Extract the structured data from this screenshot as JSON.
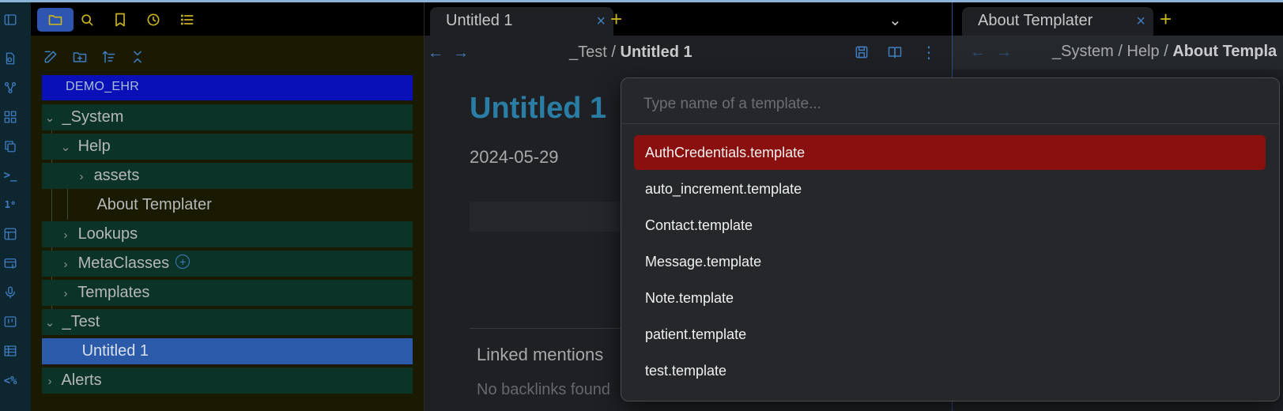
{
  "ribbon": {
    "icons": [
      "sidebar-toggle-icon",
      "new-note-icon",
      "graph-icon",
      "canvas-icon",
      "copy-icon",
      "terminal-icon",
      "numbers-icon",
      "template-icon",
      "card-add-icon",
      "microphone-icon",
      "kanban-icon",
      "table-icon",
      "templater-icon"
    ],
    "terminal_glyph": ">_",
    "numbers_glyph": "1⁰",
    "templater_glyph": "<%"
  },
  "sidebar": {
    "vault_name": "DEMO_EHR",
    "tree": [
      {
        "label": "_System",
        "chevron": "⌄"
      },
      {
        "label": "Help",
        "chevron": "⌄"
      },
      {
        "label": "assets",
        "chevron": "›"
      },
      {
        "label": "About Templater",
        "chevron": ""
      },
      {
        "label": "Lookups",
        "chevron": "›"
      },
      {
        "label": "MetaClasses",
        "chevron": "›"
      },
      {
        "label": "Templates",
        "chevron": "›"
      },
      {
        "label": "_Test",
        "chevron": "⌄"
      },
      {
        "label": "Untitled 1",
        "chevron": ""
      },
      {
        "label": "Alerts",
        "chevron": "›"
      }
    ],
    "plus_glyph": "+"
  },
  "editor": {
    "tab_title": "Untitled 1",
    "tab_close": "×",
    "new_tab": "+",
    "tab_list": "⌄",
    "back": "←",
    "forward": "→",
    "breadcrumb_parent": "_Test",
    "breadcrumb_sep": "/",
    "breadcrumb_current": "Untitled 1",
    "more": "⋮",
    "note_title": "Untitled 1",
    "note_date": "2024-05-29",
    "linked_mentions": "Linked mentions",
    "no_backlinks": "No backlinks found"
  },
  "right_pane": {
    "tab_title": "About Templater",
    "tab_close": "×",
    "new_tab": "+",
    "back": "←",
    "forward": "→",
    "breadcrumb_a": "_System",
    "breadcrumb_b": "Help",
    "breadcrumb_sep": "/",
    "breadcrumb_current": "About Templa"
  },
  "template_picker": {
    "placeholder": "Type name of a template...",
    "suggestions": [
      "AuthCredentials.template",
      "auto_increment.template",
      "Contact.template",
      "Message.template",
      "Note.template",
      "patient.template",
      "test.template"
    ],
    "active_index": 0
  },
  "colors": {
    "accent_blue": "#3f7dc0",
    "accent_yellow": "#c9b21f",
    "folder_bg": "#0c3328",
    "selected_bg": "#2b5aa8",
    "vault_bg": "#0a10b8",
    "suggestion_active": "#8a1010",
    "note_title": "#2a7ea6"
  }
}
